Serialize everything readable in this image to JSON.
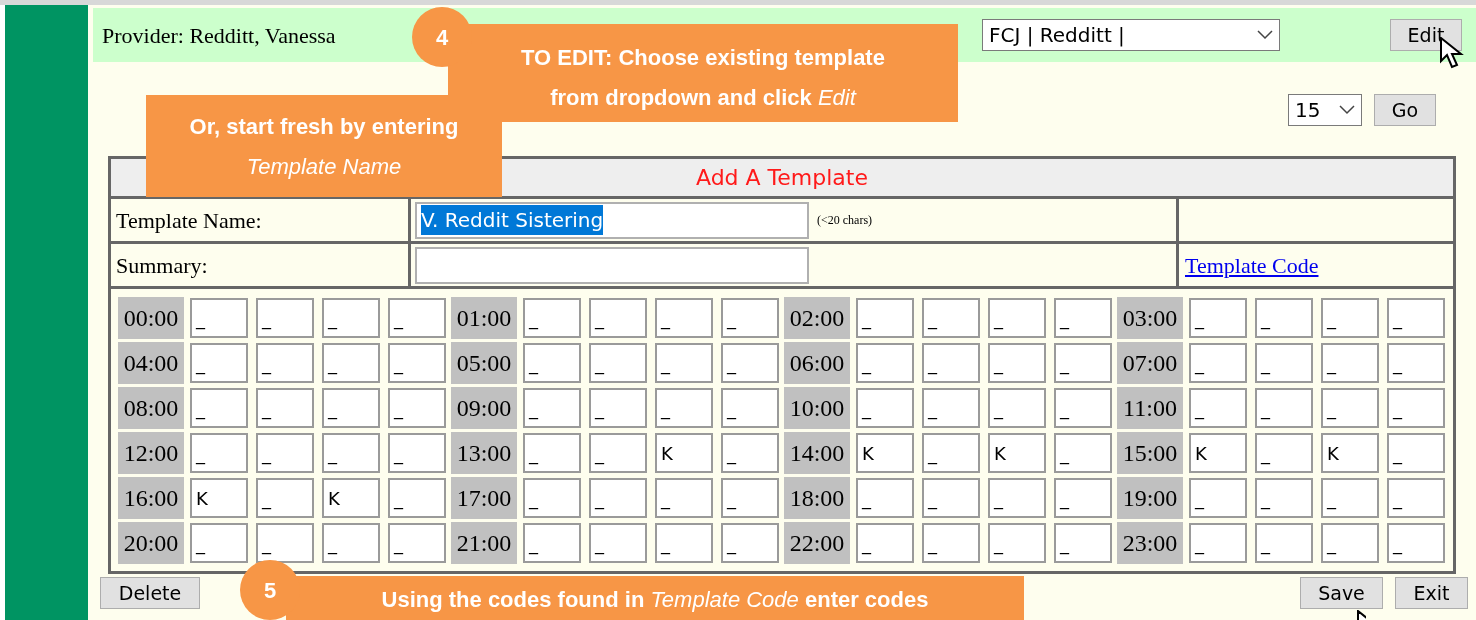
{
  "provider_bar": {
    "label": "Provider: Redditt, Vanessa",
    "template_select": "FCJ | Redditt |",
    "edit_button": "Edit"
  },
  "page_controls": {
    "count_select": "15",
    "go_button": "Go"
  },
  "form": {
    "title": "Add A Template",
    "name_label": "Template Name:",
    "name_value": "V. Reddit Sistering",
    "name_selected": true,
    "name_hint": "(<20 chars)",
    "summary_label": "Summary:",
    "template_code_link": "Template Code"
  },
  "grid": [
    {
      "time": "00:00",
      "slots": [
        "_",
        "_",
        "_",
        "_"
      ]
    },
    {
      "time": "01:00",
      "slots": [
        "_",
        "_",
        "_",
        "_"
      ]
    },
    {
      "time": "02:00",
      "slots": [
        "_",
        "_",
        "_",
        "_"
      ]
    },
    {
      "time": "03:00",
      "slots": [
        "_",
        "_",
        "_",
        "_"
      ]
    },
    {
      "time": "04:00",
      "slots": [
        "_",
        "_",
        "_",
        "_"
      ]
    },
    {
      "time": "05:00",
      "slots": [
        "_",
        "_",
        "_",
        "_"
      ]
    },
    {
      "time": "06:00",
      "slots": [
        "_",
        "_",
        "_",
        "_"
      ]
    },
    {
      "time": "07:00",
      "slots": [
        "_",
        "_",
        "_",
        "_"
      ]
    },
    {
      "time": "08:00",
      "slots": [
        "_",
        "_",
        "_",
        "_"
      ]
    },
    {
      "time": "09:00",
      "slots": [
        "_",
        "_",
        "_",
        "_"
      ]
    },
    {
      "time": "10:00",
      "slots": [
        "_",
        "_",
        "_",
        "_"
      ]
    },
    {
      "time": "11:00",
      "slots": [
        "_",
        "_",
        "_",
        "_"
      ]
    },
    {
      "time": "12:00",
      "slots": [
        "_",
        "_",
        "_",
        "_"
      ]
    },
    {
      "time": "13:00",
      "slots": [
        "_",
        "_",
        "K",
        "_"
      ]
    },
    {
      "time": "14:00",
      "slots": [
        "K",
        "_",
        "K",
        "_"
      ]
    },
    {
      "time": "15:00",
      "slots": [
        "K",
        "_",
        "K",
        "_"
      ]
    },
    {
      "time": "16:00",
      "slots": [
        "K",
        "_",
        "K",
        "_"
      ]
    },
    {
      "time": "17:00",
      "slots": [
        "_",
        "_",
        "_",
        "_"
      ]
    },
    {
      "time": "18:00",
      "slots": [
        "_",
        "_",
        "_",
        "_"
      ]
    },
    {
      "time": "19:00",
      "slots": [
        "_",
        "_",
        "_",
        "_"
      ]
    },
    {
      "time": "20:00",
      "slots": [
        "_",
        "_",
        "_",
        "_"
      ]
    },
    {
      "time": "21:00",
      "slots": [
        "_",
        "_",
        "_",
        "_"
      ]
    },
    {
      "time": "22:00",
      "slots": [
        "_",
        "_",
        "_",
        "_"
      ]
    },
    {
      "time": "23:00",
      "slots": [
        "_",
        "_",
        "_",
        "_"
      ]
    }
  ],
  "footer": {
    "delete_button": "Delete",
    "save_button": "Save",
    "exit_button": "Exit"
  },
  "callouts": [
    {
      "step": "4",
      "lines": [
        "TO EDIT: Choose existing template",
        "from dropdown and click *Edit*"
      ]
    },
    {
      "lines": [
        "Or, start fresh by entering",
        "*Template Name*"
      ]
    },
    {
      "step": "5",
      "lines": [
        "Using the codes found in *Template Code* enter codes"
      ]
    }
  ]
}
